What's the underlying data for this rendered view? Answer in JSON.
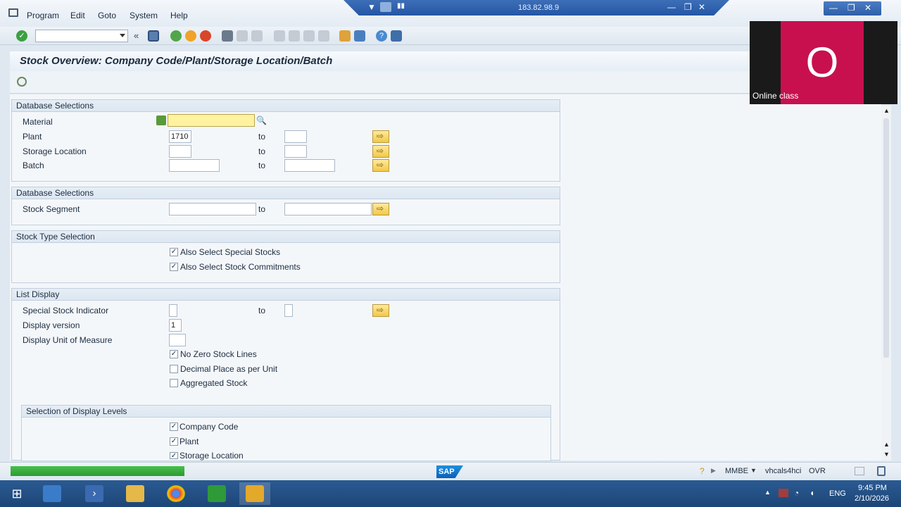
{
  "menubar": {
    "items": [
      "Program",
      "Edit",
      "Goto",
      "System",
      "Help"
    ],
    "remote_ip": "183.82.98.9"
  },
  "toolbar": {
    "command_field_value": "",
    "icons": [
      "enter-icon",
      "back-arrows-icon",
      "save-icon",
      "back-icon",
      "exit-icon",
      "cancel-icon",
      "print-icon",
      "find-icon",
      "find-next-icon",
      "first-page-icon",
      "previous-page-icon",
      "next-page-icon",
      "last-page-icon",
      "create-session-icon",
      "shortcut-icon",
      "help-icon",
      "customize-layout-icon"
    ]
  },
  "title": "Stock Overview: Company Code/Plant/Storage Location/Batch",
  "groups": {
    "db_selections_1": {
      "title": "Database Selections",
      "rows": [
        {
          "label": "Material",
          "from": "",
          "to": null
        },
        {
          "label": "Plant",
          "from": "1710",
          "to_label": "to",
          "to": ""
        },
        {
          "label": "Storage Location",
          "from": "",
          "to_label": "to",
          "to": ""
        },
        {
          "label": "Batch",
          "from": "",
          "to_label": "to",
          "to": ""
        }
      ]
    },
    "db_selections_2": {
      "title": "Database Selections",
      "rows": [
        {
          "label": "Stock Segment",
          "from": "",
          "to_label": "to",
          "to": ""
        }
      ]
    },
    "stock_type": {
      "title": "Stock Type Selection",
      "checks": [
        {
          "label": "Also Select Special Stocks",
          "checked": true
        },
        {
          "label": "Also Select Stock Commitments",
          "checked": true
        }
      ]
    },
    "list_display": {
      "title": "List Display",
      "rows": [
        {
          "label": "Special Stock Indicator",
          "from": "",
          "to_label": "to",
          "to": ""
        },
        {
          "label": "Display version",
          "from": "1"
        },
        {
          "label": "Display Unit of Measure",
          "from": ""
        }
      ],
      "checks": [
        {
          "label": "No Zero Stock Lines",
          "checked": true
        },
        {
          "label": "Decimal Place as per Unit",
          "checked": false
        },
        {
          "label": "Aggregated Stock",
          "checked": false
        }
      ]
    },
    "display_levels": {
      "title": "Selection of Display Levels",
      "checks": [
        {
          "label": "Company Code",
          "checked": true
        },
        {
          "label": "Plant",
          "checked": true
        },
        {
          "label": "Storage Location",
          "checked": true
        }
      ]
    }
  },
  "video_overlay": {
    "initial": "O",
    "caption": "Online class"
  },
  "statusbar": {
    "progress": 1.0,
    "sap_logo": "SAP",
    "transaction": "MMBE",
    "server": "vhcals4hci",
    "mode": "OVR"
  },
  "taskbar": {
    "language": "ENG",
    "time": "9:45 PM",
    "date": "2/10/2026"
  }
}
